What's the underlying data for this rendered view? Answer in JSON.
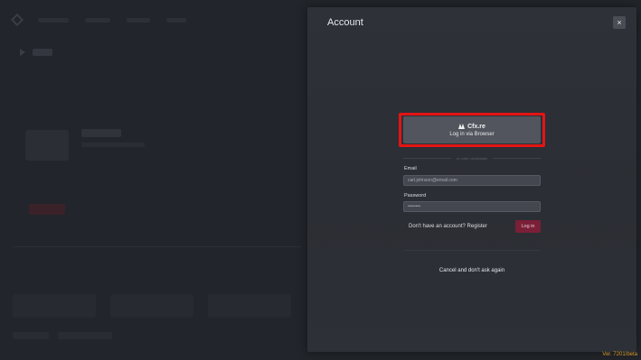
{
  "account_dialog": {
    "title": "Account",
    "close_icon": "×",
    "browser_login": {
      "brand": "Cfx.re",
      "label": "Log in via Browser",
      "highlight_color": "#e41414"
    },
    "divider_text": "or enter credentials",
    "email": {
      "label": "Email",
      "value": "carl.johnson@email.com"
    },
    "password": {
      "label": "Password",
      "value": "••••••••"
    },
    "register_text": "Don't have an account? Register",
    "login_button": "Log in",
    "cancel_link": "Cancel and don't ask again"
  },
  "version": "Ver. 7201/beta",
  "colors": {
    "accent": "#7a1f37",
    "version_text": "#d79a2e",
    "panel_bg": "#2e3138"
  }
}
